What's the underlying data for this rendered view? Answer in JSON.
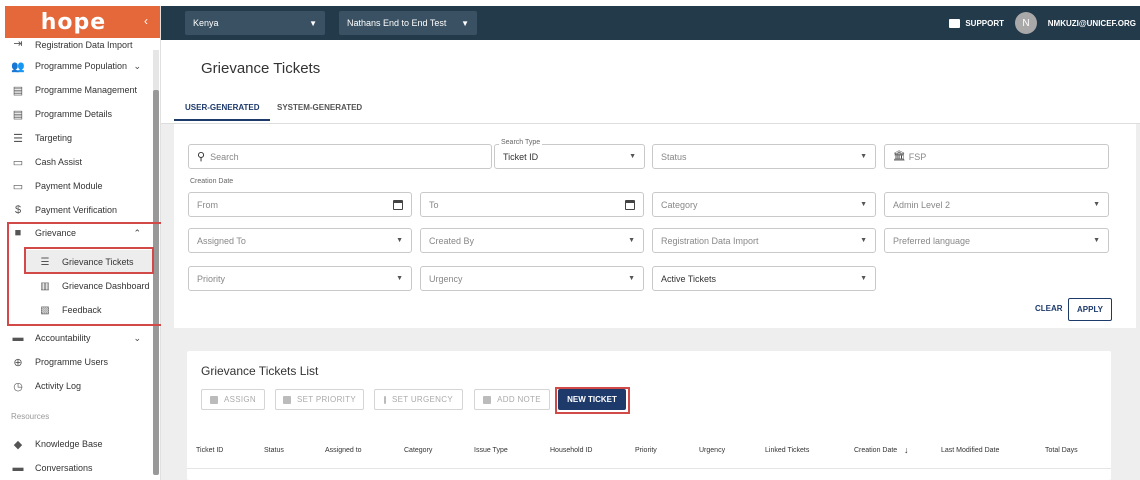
{
  "app": {
    "logo": "hope",
    "collapse_icon": "chevron-left-icon"
  },
  "topbar": {
    "country": "Kenya",
    "programme": "Nathans End to End Test",
    "support_label": "SUPPORT",
    "avatar_initial": "N",
    "user_email": "NMKUZI@UNICEF.ORG"
  },
  "sidebar": {
    "partial_item": "Registration Data Import",
    "items": [
      {
        "label": "Programme Population",
        "icon": "people-icon"
      },
      {
        "label": "Programme Management",
        "icon": "clipboard-icon"
      },
      {
        "label": "Programme Details",
        "icon": "clipboard-icon"
      },
      {
        "label": "Targeting",
        "icon": "list-icon"
      },
      {
        "label": "Cash Assist",
        "icon": "card-icon"
      },
      {
        "label": "Payment Module",
        "icon": "card-icon"
      },
      {
        "label": "Payment Verification",
        "icon": "dollar-icon"
      },
      {
        "label": "Grievance",
        "icon": "alert-icon"
      },
      {
        "label": "Grievance Tickets",
        "icon": "list-icon"
      },
      {
        "label": "Grievance Dashboard",
        "icon": "chart-icon"
      },
      {
        "label": "Feedback",
        "icon": "feedback-icon"
      },
      {
        "label": "Accountability",
        "icon": "message-icon"
      },
      {
        "label": "Programme Users",
        "icon": "users-icon"
      },
      {
        "label": "Activity Log",
        "icon": "history-icon"
      }
    ],
    "section_resources": "Resources",
    "resources": [
      {
        "label": "Knowledge Base",
        "icon": "book-icon"
      },
      {
        "label": "Conversations",
        "icon": "chat-icon"
      }
    ]
  },
  "header": {
    "title": "Grievance Tickets",
    "tabs": [
      "USER-GENERATED",
      "SYSTEM-GENERATED"
    ]
  },
  "filters": {
    "search_placeholder": "Search",
    "search_type_label": "Search Type",
    "search_type_value": "Ticket ID",
    "status": "Status",
    "fsp": "FSP",
    "creation_date_label": "Creation Date",
    "from": "From",
    "to": "To",
    "category": "Category",
    "admin_level": "Admin Level 2",
    "assigned_to": "Assigned To",
    "created_by": "Created By",
    "registration_data_import": "Registration Data Import",
    "preferred_language": "Preferred language",
    "priority": "Priority",
    "urgency": "Urgency",
    "active_tickets": "Active Tickets",
    "clear": "CLEAR",
    "apply": "APPLY"
  },
  "list": {
    "title": "Grievance Tickets List",
    "actions": [
      "ASSIGN",
      "SET PRIORITY",
      "SET URGENCY",
      "ADD NOTE"
    ],
    "new_ticket": "NEW TICKET",
    "columns": [
      "Ticket ID",
      "Status",
      "Assigned to",
      "Category",
      "Issue Type",
      "Household ID",
      "Priority",
      "Urgency",
      "Linked Tickets",
      "Creation Date",
      "Last Modified Date",
      "Total Days"
    ],
    "sort_icon": "arrow-down-icon"
  },
  "colors": {
    "brand": "#e4683a",
    "topbar": "#233a4a",
    "primary": "#1d3a6b",
    "highlight": "#d24a48"
  }
}
